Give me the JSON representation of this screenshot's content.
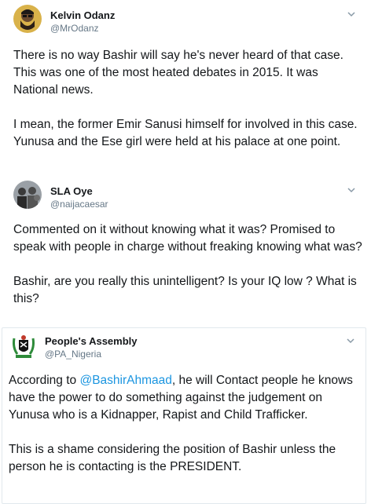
{
  "tweets": [
    {
      "name": "Kelvin Odanz",
      "handle": "@MrOdanz",
      "avatar_icon": "bearded-man-avatar-icon",
      "paragraphs": [
        "There is no way Bashir will say he's never heard of that case. This was one of the most heated debates in 2015. It was National news.",
        "I mean, the former Emir Sanusi himself for involved in this case. Yunusa and the Ese girl were held at his palace at one point."
      ]
    },
    {
      "name": "SLA Oye",
      "handle": "@naijacaesar",
      "avatar_icon": "group-photo-avatar-icon",
      "paragraphs": [
        "Commented on it without knowing what it was? Promised to speak with people in charge without freaking knowing what was?",
        "Bashir, are you really this unintelligent? Is your IQ low ? What is this?"
      ]
    },
    {
      "name": "People's Assembly",
      "handle": "@PA_Nigeria",
      "avatar_icon": "coat-of-arms-avatar-icon",
      "p1_before": "According to ",
      "mention": "@BashirAhmaad",
      "p1_after": ", he will Contact people he knows have the power to do something against the judgement on Yunusa who is a Kidnapper, Rapist and Child Trafficker.",
      "p2": "This is a shame considering the position of Bashir unless the person he is contacting is the PRESIDENT."
    }
  ],
  "colors": {
    "name": "#14171a",
    "handle": "#657786",
    "mention": "#1b95e0",
    "border": "#e1e8ed"
  }
}
